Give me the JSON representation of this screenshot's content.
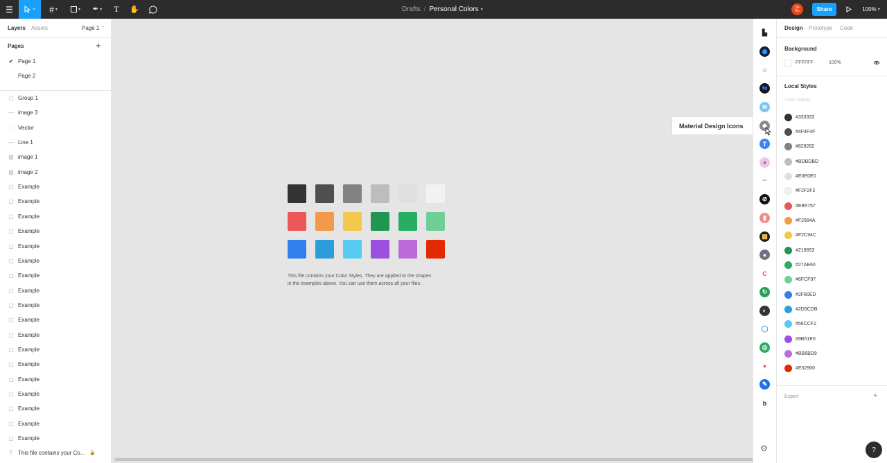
{
  "topbar": {
    "breadcrumb_parent": "Drafts",
    "breadcrumb_sep": "/",
    "file_name": "Personal Colors",
    "avatar_text": "De Ro",
    "share_label": "Share",
    "zoom": "100%"
  },
  "left": {
    "tabs": [
      "Layers",
      "Assets"
    ],
    "page_selector": "Page 1",
    "pages_title": "Pages",
    "pages": [
      "Page 1",
      "Page 2"
    ],
    "layers": [
      {
        "label": "Group 1",
        "icon": "frame-icon"
      },
      {
        "label": "image 3",
        "icon": "line-icon"
      },
      {
        "label": "Vector",
        "icon": "vector-icon"
      },
      {
        "label": "Line 1",
        "icon": "line-icon"
      },
      {
        "label": "image 1",
        "icon": "image-icon"
      },
      {
        "label": "image 2",
        "icon": "image-icon"
      },
      {
        "label": "Example",
        "icon": "rect-icon"
      },
      {
        "label": "Example",
        "icon": "rect-icon"
      },
      {
        "label": "Example",
        "icon": "rect-icon"
      },
      {
        "label": "Example",
        "icon": "rect-icon"
      },
      {
        "label": "Example",
        "icon": "rect-icon"
      },
      {
        "label": "Example",
        "icon": "rect-icon"
      },
      {
        "label": "Example",
        "icon": "rect-icon"
      },
      {
        "label": "Example",
        "icon": "rect-icon"
      },
      {
        "label": "Example",
        "icon": "rect-icon"
      },
      {
        "label": "Example",
        "icon": "rect-icon"
      },
      {
        "label": "Example",
        "icon": "rect-icon"
      },
      {
        "label": "Example",
        "icon": "rect-icon"
      },
      {
        "label": "Example",
        "icon": "rect-icon"
      },
      {
        "label": "Example",
        "icon": "rect-icon"
      },
      {
        "label": "Example",
        "icon": "rect-icon"
      },
      {
        "label": "Example",
        "icon": "rect-icon"
      },
      {
        "label": "Example",
        "icon": "rect-icon"
      },
      {
        "label": "Example",
        "icon": "rect-icon"
      },
      {
        "label": "This file contains your Co...",
        "icon": "text-icon"
      }
    ]
  },
  "canvas": {
    "swatches": [
      "#333333",
      "#4F4F4F",
      "#828282",
      "#BDBDBD",
      "#E0E0E0",
      "#F2F2F2",
      "#EB5757",
      "#F2994A",
      "#F2C94C",
      "#219653",
      "#27AE60",
      "#6FCF97",
      "#2F80ED",
      "#2D9CDB",
      "#56CCF2",
      "#9B51E0",
      "#BB6BD9",
      "#E32900"
    ],
    "description_line1": "This file contains your Color Styles. They are applied to the shapes",
    "description_line2": "in the examples above. You can use them across all your files.",
    "tooltip": "Material Design Icons"
  },
  "plugins": [
    {
      "color": "#ffffff",
      "fg": "#222222",
      "glyph": "▙"
    },
    {
      "color": "#0e1f3d",
      "fg": "#3aa0ff",
      "glyph": "◉"
    },
    {
      "color": "#ffffff",
      "fg": "#2f9ee6",
      "glyph": "☺"
    },
    {
      "color": "#111827",
      "fg": "#3b82f6",
      "glyph": "⇋"
    },
    {
      "color": "#7cc6f0",
      "fg": "#ffffff",
      "glyph": "≋"
    },
    {
      "color": "#8a8a8a",
      "fg": "#ffffff",
      "glyph": "◆"
    },
    {
      "color": "#3b82f6",
      "fg": "#ffffff",
      "glyph": "T"
    },
    {
      "color": "#f3c4e6",
      "fg": "#4b6cb7",
      "glyph": "◕"
    },
    {
      "color": "#ffffff",
      "fg": "#9ab7a0",
      "glyph": "•••"
    },
    {
      "color": "#111111",
      "fg": "#ffffff",
      "glyph": "⊘"
    },
    {
      "color": "#f28b82",
      "fg": "#ffffff",
      "glyph": "▮"
    },
    {
      "color": "#1f1f1f",
      "fg": "#f2c94c",
      "glyph": "▦"
    },
    {
      "color": "#6b7280",
      "fg": "#ffffff",
      "glyph": "●"
    },
    {
      "color": "#ffffff",
      "fg": "#e84c89",
      "glyph": "C"
    },
    {
      "color": "#22a35a",
      "fg": "#ffffff",
      "glyph": "↻"
    },
    {
      "color": "#333333",
      "fg": "#ffffff",
      "glyph": "◐"
    },
    {
      "color": "#ffffff",
      "fg": "#1d9bf0",
      "glyph": "◯"
    },
    {
      "color": "#27ae60",
      "fg": "#ffffff",
      "glyph": "◎"
    },
    {
      "color": "#ffffff",
      "fg": "#eb5757",
      "glyph": "●"
    },
    {
      "color": "#1a73e8",
      "fg": "#ffffff",
      "glyph": "✎"
    },
    {
      "color": "#ffffff",
      "fg": "#222222",
      "glyph": "b"
    }
  ],
  "right": {
    "tabs": [
      "Design",
      "Prototype",
      "Code"
    ],
    "background_title": "Background",
    "background_hex": "FFFFFF",
    "background_opacity": "100%",
    "local_styles_title": "Local Styles",
    "color_styles_title": "Color Styles",
    "color_styles": [
      "#333333",
      "#4F4F4F",
      "#828282",
      "#BDBDBD",
      "#E0E0E0",
      "#F2F2F2",
      "#EB5757",
      "#F2994A",
      "#F2C94C",
      "#219653",
      "#27AE60",
      "#6FCF97",
      "#2F80ED",
      "#2D9CDB",
      "#56CCF2",
      "#9B51E0",
      "#BB6BD9",
      "#E32900"
    ],
    "export_title": "Export",
    "help": "?"
  },
  "colors": {
    "accent": "#18a0fb",
    "toolbar": "#2c2c2c"
  }
}
